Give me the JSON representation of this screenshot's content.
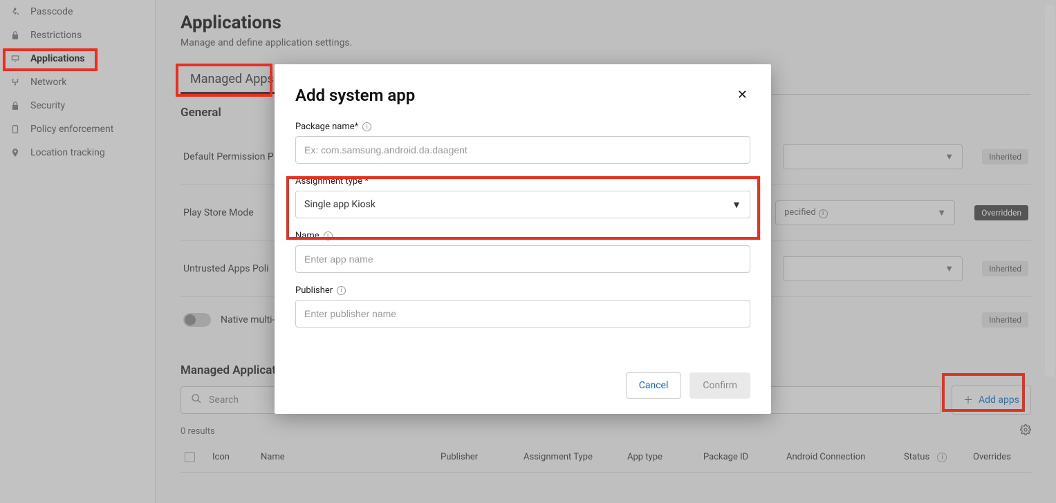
{
  "sidebar": {
    "items": [
      {
        "label": "Passcode"
      },
      {
        "label": "Restrictions"
      },
      {
        "label": "Applications"
      },
      {
        "label": "Network"
      },
      {
        "label": "Security"
      },
      {
        "label": "Policy enforcement"
      },
      {
        "label": "Location tracking"
      }
    ]
  },
  "page": {
    "title": "Applications",
    "subtitle": "Manage and define application settings."
  },
  "tabs": {
    "managed_apps": "Managed Apps"
  },
  "general": {
    "heading": "General",
    "rows": {
      "default_permission": {
        "label": "Default Permission P",
        "badge": "Inherited"
      },
      "play_store_mode": {
        "label": "Play Store Mode",
        "select_visible": "pecified",
        "badge": "Overridden"
      },
      "untrusted_apps": {
        "label": "Untrusted Apps Poli",
        "badge": "Inherited"
      },
      "native_multi": {
        "label": "Native multi-",
        "badge": "Inherited"
      }
    }
  },
  "managed_apps_section": {
    "heading": "Managed Applicati",
    "search_placeholder": "Search",
    "add_apps_label": "Add apps",
    "results_count": "0 results",
    "columns": {
      "icon": "Icon",
      "name": "Name",
      "publisher": "Publisher",
      "assignment_type": "Assignment Type",
      "app_type": "App type",
      "package_id": "Package ID",
      "android_connection": "Android Connection",
      "status": "Status",
      "overrides": "Overrides"
    }
  },
  "modal": {
    "title": "Add system app",
    "fields": {
      "package_name_label": "Package name*",
      "package_name_placeholder": "Ex: com.samsung.android.da.daagent",
      "assignment_type_label": "Assignment type *",
      "assignment_type_value": "Single app Kiosk",
      "name_label": "Name",
      "name_placeholder": "Enter app name",
      "publisher_label": "Publisher",
      "publisher_placeholder": "Enter publisher name"
    },
    "buttons": {
      "cancel": "Cancel",
      "confirm": "Confirm"
    }
  }
}
